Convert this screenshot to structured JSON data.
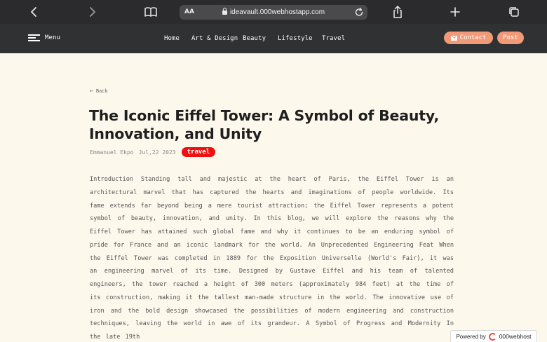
{
  "browser": {
    "text_size_label": "AA",
    "url": "ideavault.000webhostapp.com",
    "icons": {
      "back": "chevron-left-icon",
      "forward": "chevron-right-icon",
      "reader": "book-icon",
      "reload": "reload-icon",
      "share": "share-icon",
      "new_tab": "plus-icon",
      "tabs": "tabs-icon"
    }
  },
  "nav": {
    "menu_label": "Menu",
    "links": [
      "Home",
      "Art & Design",
      "Beauty",
      "Lifestyle",
      "Travel"
    ],
    "contact_label": "Contact",
    "post_label": "Post"
  },
  "article": {
    "back_label": "Back",
    "title": "The Iconic Eiffel Tower: A Symbol of Beauty, Innovation, and Unity",
    "author": "Emmanuel Ekpo",
    "date": "Jul,22 2023",
    "tag": "travel",
    "body": "Introduction Standing tall and majestic at the heart of Paris, the Eiffel Tower is an architectural marvel that has captured the hearts and imaginations of people worldwide. Its fame extends far beyond being a mere tourist attraction; the Eiffel Tower represents a potent symbol of beauty, innovation, and unity. In this blog, we will explore the reasons why the Eiffel Tower has attained such global fame and why it continues to be an enduring symbol of pride for France and an iconic landmark for the world. An Unprecedented Engineering Feat When the Eiffel Tower was completed in 1889 for the Exposition Universelle (World's Fair), it was an engineering marvel of its time. Designed by Gustave Eiffel and his team of talented engineers, the tower reached a height of 300 meters (approximately 984 feet) at the time of its construction, making it the tallest man-made structure in the world. The innovative use of iron and the bold design showcased the possibilities of modern engineering and construction techniques, leaving the world in awe of its grandeur. A Symbol of Progress and Modernity In the late 19th"
  },
  "badge": {
    "label": "Powered by",
    "brand": "000webhost"
  },
  "colors": {
    "page_background": "#fdf8ec",
    "nav_background": "#303133",
    "accent": "#f29a78",
    "tag": "#ee1111"
  }
}
